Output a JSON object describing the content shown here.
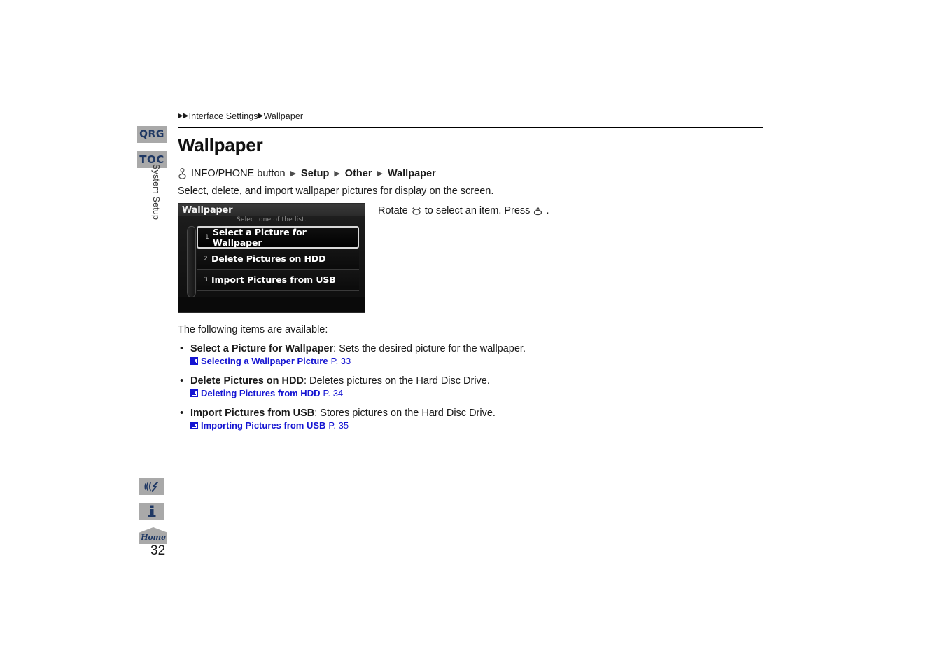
{
  "document": {
    "page_number": "32",
    "breadcrumb": {
      "arrow_glyph": "▶",
      "level1": "Interface Settings",
      "level2": "Wallpaper"
    },
    "title": "Wallpaper",
    "menu_path": {
      "knob_icon": "rotary-knob-icon",
      "button": "INFO/PHONE button",
      "separator": "▶",
      "steps": [
        "Setup",
        "Other",
        "Wallpaper"
      ]
    },
    "intro": "Select, delete, and import wallpaper pictures for display on the screen.",
    "available_intro": "The following items are available:"
  },
  "sidebar": {
    "tabs": [
      {
        "label": "QRG",
        "name": "tab-qrg"
      },
      {
        "label": "TOC",
        "name": "tab-toc"
      }
    ],
    "section_label": "System Setup",
    "bottom_icons": [
      {
        "name": "voice-command-icon",
        "label": ""
      },
      {
        "name": "info-icon",
        "label": ""
      },
      {
        "name": "home-icon",
        "label": "Home"
      }
    ]
  },
  "nav_screen": {
    "title": "Wallpaper",
    "subtitle": "Select one of the list.",
    "items": [
      {
        "number": "1",
        "label": "Select a Picture for Wallpaper",
        "selected": true
      },
      {
        "number": "2",
        "label": "Delete Pictures on HDD",
        "selected": false
      },
      {
        "number": "3",
        "label": "Import Pictures from USB",
        "selected": false
      }
    ]
  },
  "screen_note": {
    "part1": "Rotate",
    "rotate_icon": "rotate-knob-icon",
    "part2": "to select an item. Press",
    "press_icon": "press-knob-icon",
    "part3": "."
  },
  "bullets": [
    {
      "term": "Select a Picture for Wallpaper",
      "description": ": Sets the desired picture for the wallpaper.",
      "ref_label": "Selecting a Wallpaper Picture",
      "ref_page": "P. 33"
    },
    {
      "term": "Delete Pictures on HDD",
      "description": ": Deletes pictures on the Hard Disc Drive.",
      "ref_label": "Deleting Pictures from HDD",
      "ref_page": "P. 34"
    },
    {
      "term": "Import Pictures from USB",
      "description": ": Stores pictures on the Hard Disc Drive.",
      "ref_label": "Importing Pictures from USB",
      "ref_page": "P. 35"
    }
  ],
  "colors": {
    "link_blue": "#1414d2",
    "tab_navy": "#1f3864",
    "tab_gray": "#a9a9a9"
  }
}
